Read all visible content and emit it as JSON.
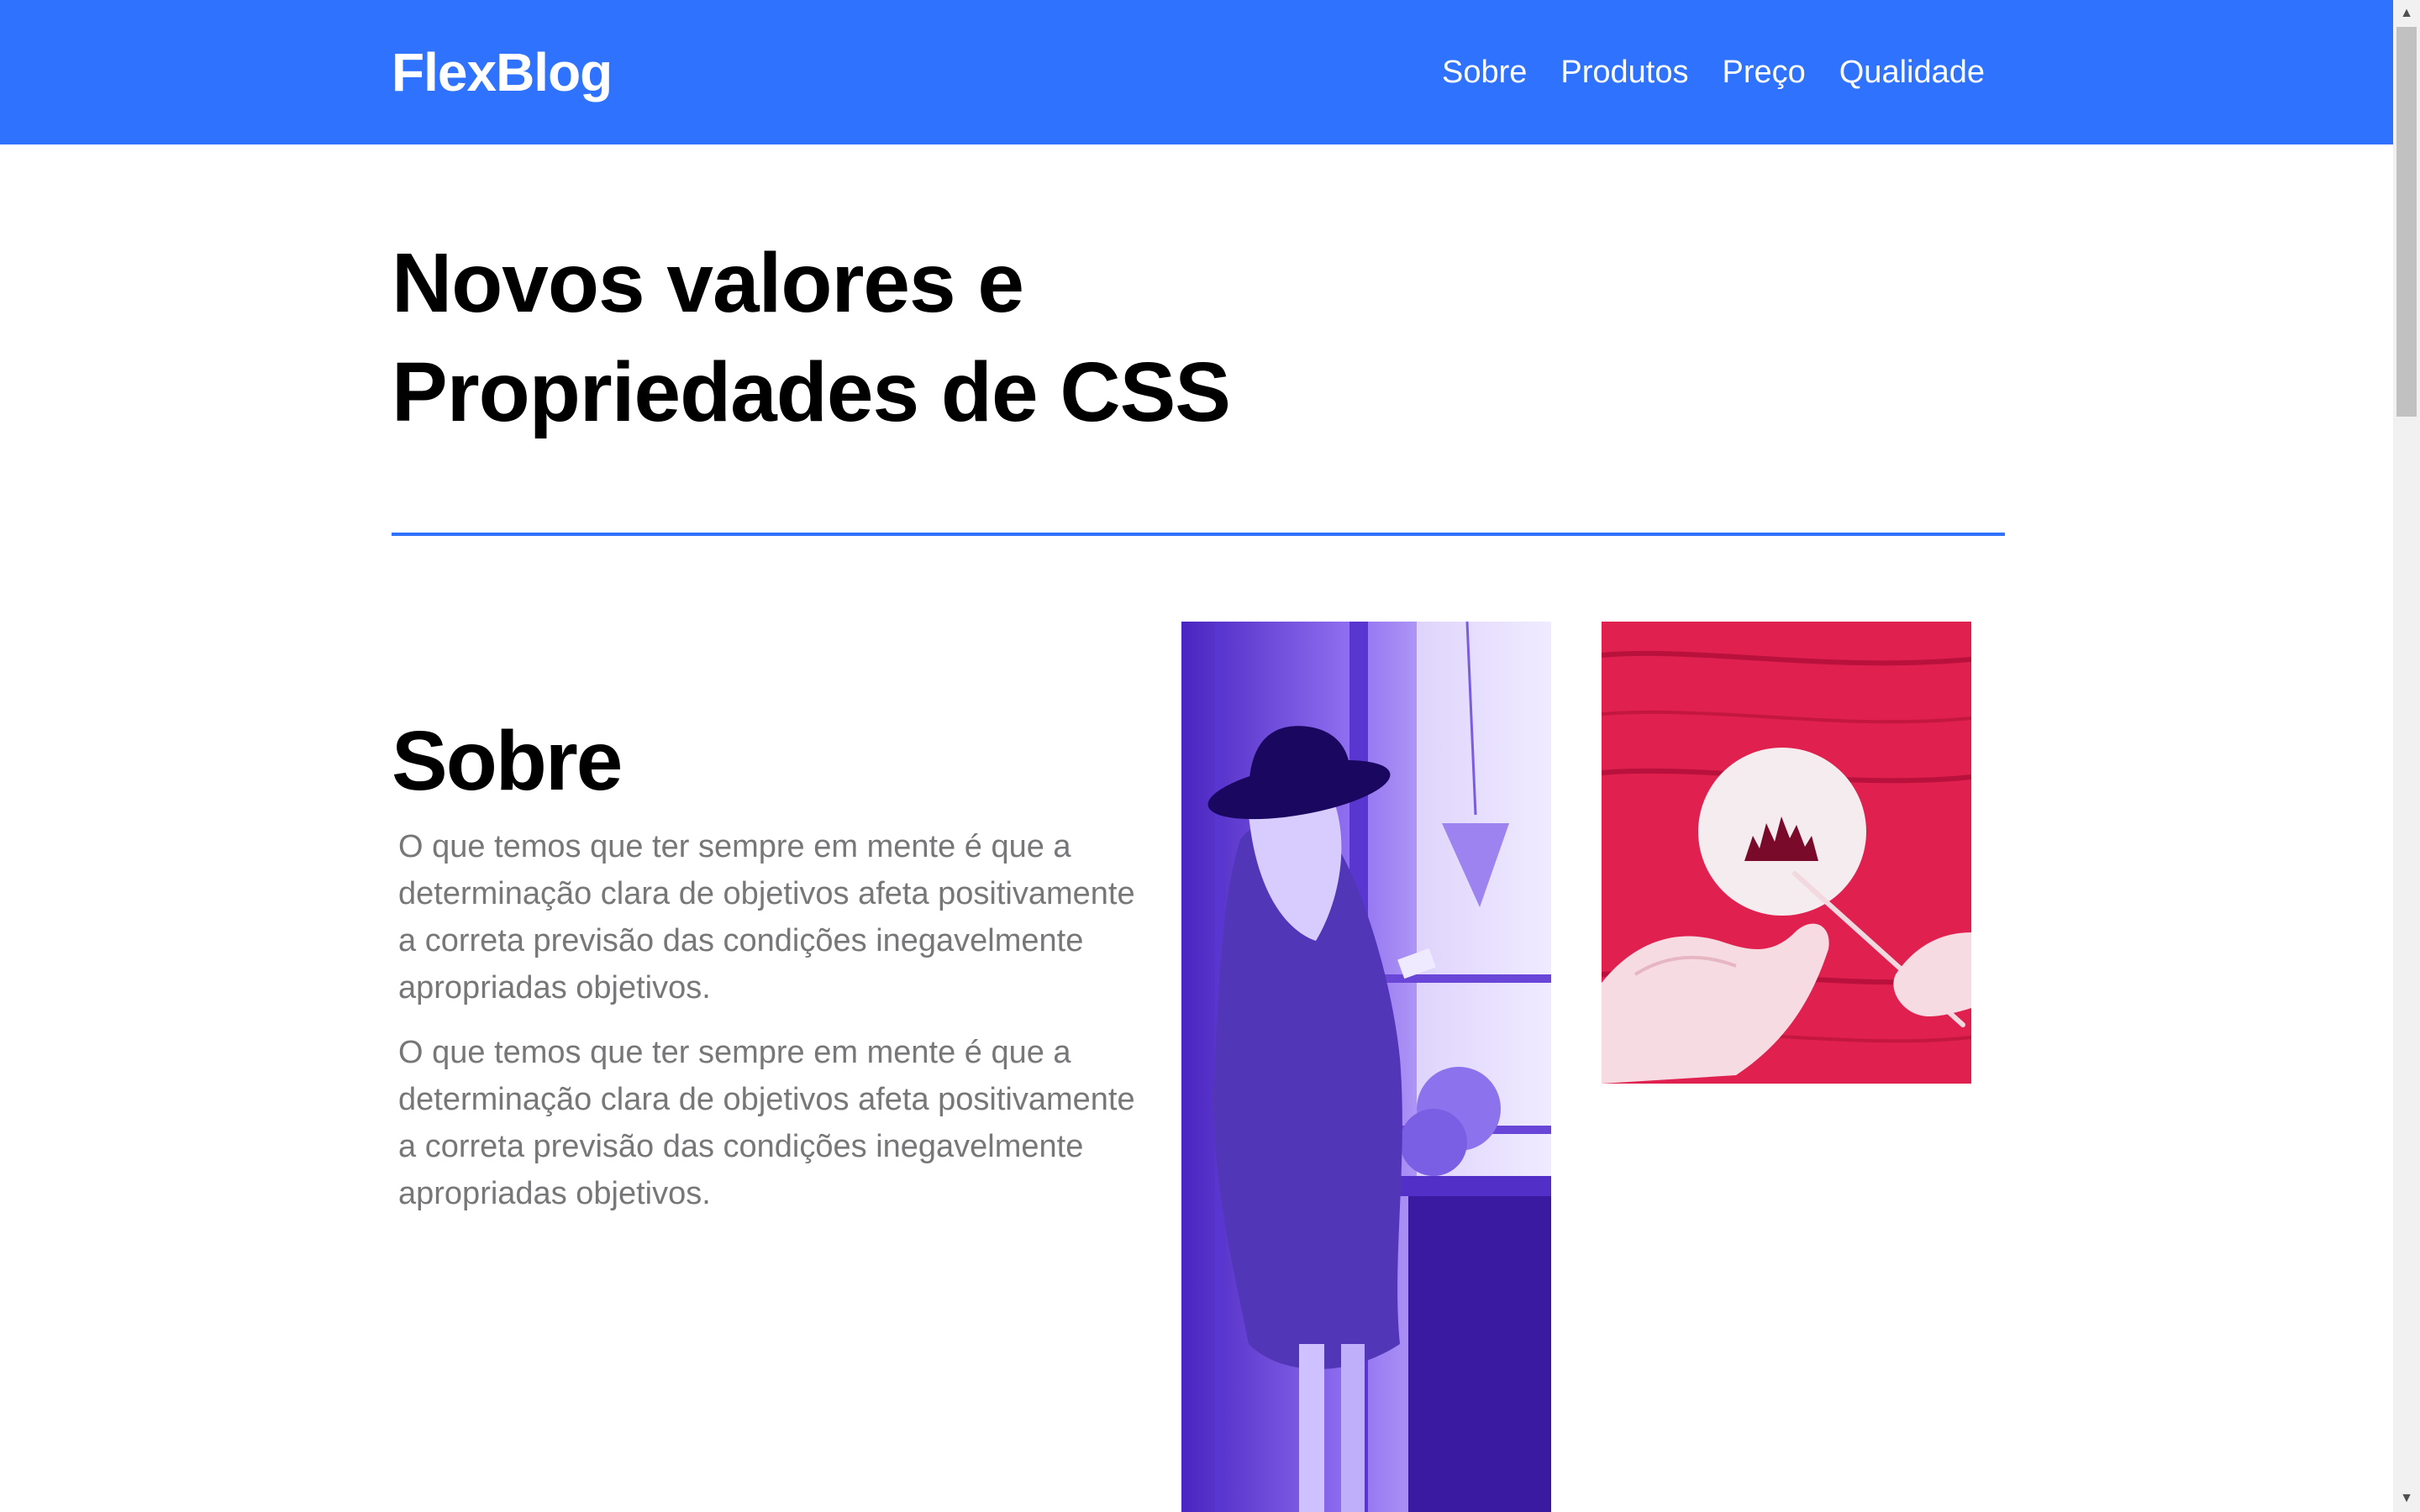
{
  "header": {
    "brand": "FlexBlog",
    "nav": [
      {
        "label": "Sobre"
      },
      {
        "label": "Produtos"
      },
      {
        "label": "Preço"
      },
      {
        "label": "Qualidade"
      }
    ]
  },
  "main": {
    "headline_line1": "Novos valores e",
    "headline_line2": "Propriedades de CSS",
    "about": {
      "title": "Sobre",
      "paragraphs": [
        "O que temos que ter sempre em mente é que a determinação clara de objetivos afeta positivamente a correta previsão das condições inegavelmente apropriadas objetivos.",
        "O que temos que ter sempre em mente é que a determinação clara de objetivos afeta positivamente a correta previsão das condições inegavelmente apropriadas objetivos."
      ]
    },
    "images": [
      {
        "name": "woman-with-hat-photo",
        "tint": "#6a40e8"
      },
      {
        "name": "painting-hands-photo",
        "tint": "#e8245a"
      }
    ]
  },
  "colors": {
    "brand_blue": "#2f72fe",
    "text_dark": "#000000",
    "text_muted": "#77777a"
  }
}
